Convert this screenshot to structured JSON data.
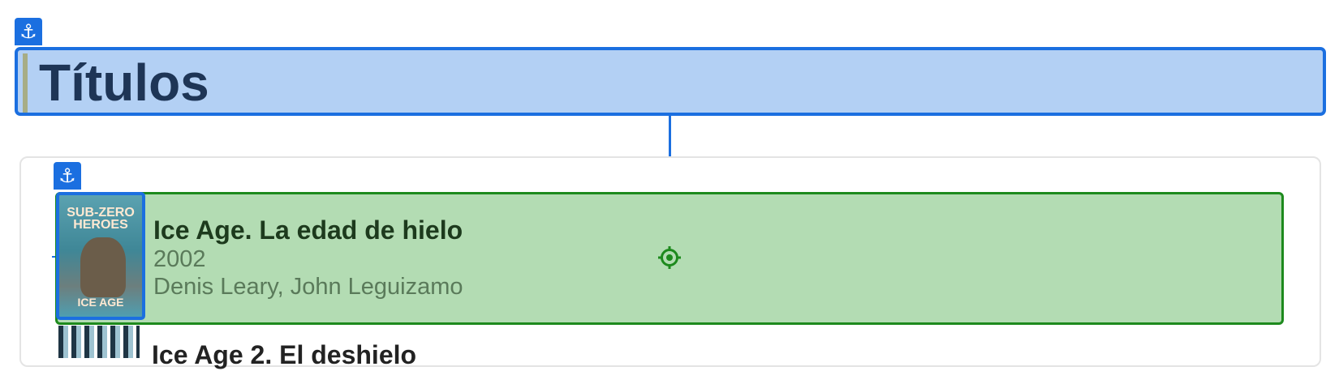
{
  "heading": {
    "title": "Títulos"
  },
  "movies": [
    {
      "title": "Ice Age. La edad de hielo",
      "year": "2002",
      "cast": "Denis Leary, John Leguizamo",
      "poster": {
        "top_text": "SUB-ZERO HEROES",
        "bottom_text": "ICE AGE"
      }
    },
    {
      "title": "Ice Age 2. El deshielo"
    }
  ],
  "icons": {
    "anchor": "⚓",
    "target": "crosshair-target"
  },
  "colors": {
    "selection_blue": "#1b6fe0",
    "heading_fill": "#b3d0f4",
    "selected_row_fill": "#b3dcb3",
    "selected_row_border": "#1d8a1d"
  }
}
